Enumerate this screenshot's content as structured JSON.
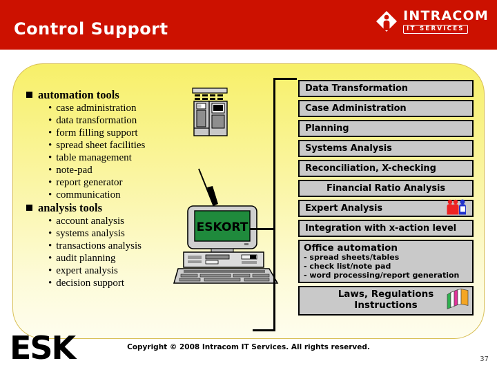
{
  "header": {
    "title": "Control Support",
    "bg_color": "#cc1100",
    "logo": {
      "mark_name": "intracom-diamond-person-icon",
      "word": "INTRACOM",
      "sub": "IT SERVICES"
    }
  },
  "panel": {
    "bg_top_color": "#f7f069",
    "bg_bottom_color": "#fefdee",
    "border_color": "#d8bf55"
  },
  "left_list": [
    {
      "level": 1,
      "text": "automation tools"
    },
    {
      "level": 2,
      "text": "case administration"
    },
    {
      "level": 2,
      "text": "data transformation"
    },
    {
      "level": 2,
      "text": "form filling support"
    },
    {
      "level": 2,
      "text": "spread sheet facilities"
    },
    {
      "level": 2,
      "text": "table management"
    },
    {
      "level": 2,
      "text": "note-pad"
    },
    {
      "level": 2,
      "text": "report generator"
    },
    {
      "level": 2,
      "text": "communication"
    },
    {
      "level": 1,
      "text": "analysis tools"
    },
    {
      "level": 2,
      "text": "account analysis"
    },
    {
      "level": 2,
      "text": "systems analysis"
    },
    {
      "level": 2,
      "text": "transactions analysis"
    },
    {
      "level": 2,
      "text": "audit planning"
    },
    {
      "level": 2,
      "text": "expert analysis"
    },
    {
      "level": 2,
      "text": "decision support"
    }
  ],
  "right_boxes": [
    {
      "label": "Data Transformation",
      "align": "left",
      "icon": ""
    },
    {
      "label": "Case Administration",
      "align": "left",
      "icon": ""
    },
    {
      "label": "Planning",
      "align": "left",
      "icon": ""
    },
    {
      "label": "Systems Analysis",
      "align": "left",
      "icon": ""
    },
    {
      "label": "Reconciliation, X-checking",
      "align": "left",
      "icon": ""
    },
    {
      "label": "Financial Ratio Analysis",
      "align": "center",
      "icon": ""
    },
    {
      "label": "Expert Analysis",
      "align": "left",
      "icon": "people-icon"
    },
    {
      "label": "Integration with x-action level",
      "align": "left",
      "icon": ""
    }
  ],
  "office_box": {
    "title": "Office automation",
    "lines": [
      "- spread sheets/tables",
      "- check list/note pad",
      "- word processing/report generation"
    ]
  },
  "laws_box": {
    "line1": "Laws, Regulations",
    "line2": "Instructions",
    "icon": "books-icon"
  },
  "artwork": {
    "cabinet_name": "server-cabinet-graphic",
    "computer_name": "desktop-computer-graphic",
    "computer_screen_text": "ESKORT",
    "computer_screen_color": "#1f8a3c"
  },
  "footer": {
    "copyright": "Copyright © 2008 Intracom IT Services. All rights reserved.",
    "page_number": "37",
    "eskort_wordmark": "ESK"
  },
  "colors": {
    "box_fill": "#c9c9c9",
    "box_border": "#000000",
    "brand_red": "#cc1100"
  }
}
